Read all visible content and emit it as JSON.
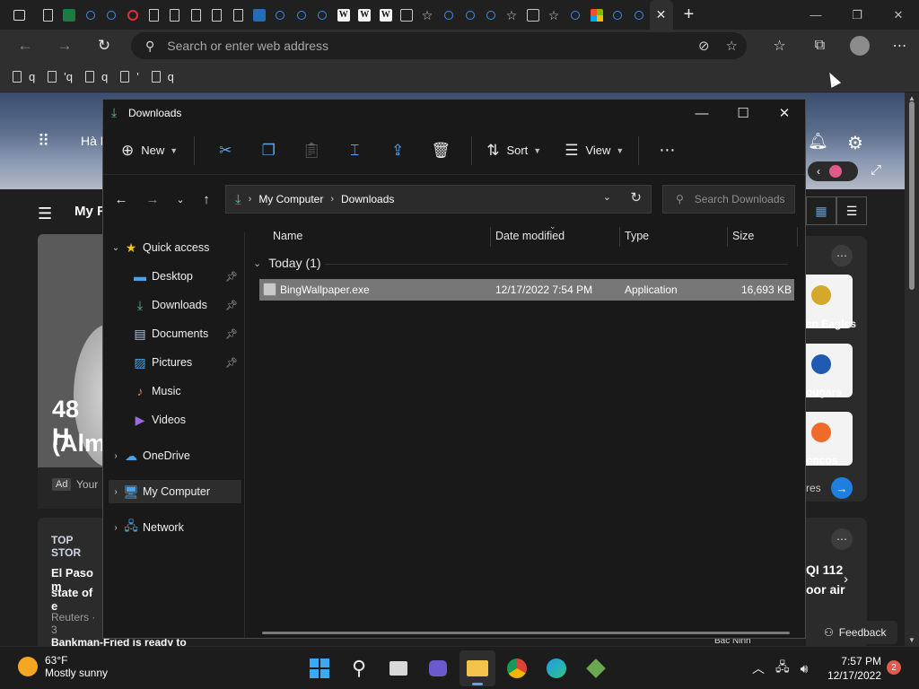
{
  "browser": {
    "address_placeholder": "Search or enter web address",
    "bookmarks": [
      {
        "label": "q"
      },
      {
        "label": "'q"
      },
      {
        "label": "q"
      },
      {
        "label": "'"
      },
      {
        "label": "q"
      }
    ]
  },
  "webpage": {
    "location": "Hà N",
    "feed_label": "My F",
    "hero_line1": "48 H",
    "hero_line2": "(Alm",
    "ad_badge": "Ad",
    "ad_text": "Your",
    "top_stories": "TOP STOR",
    "story_line1": "El Paso m",
    "story_line2": "state of e",
    "story_source": "Reuters · 3",
    "story2": "Bankman-Fried is ready to",
    "sport1": "en Eagles",
    "sport2": "ougars",
    "sport3": "oncos",
    "sports_more": "res",
    "aqi_line1": "QI 112",
    "aqi_line2": "oor air",
    "feedback": "Feedback",
    "map_label": "Bac Ninh"
  },
  "explorer": {
    "title": "Downloads",
    "commands": {
      "new": "New",
      "sort": "Sort",
      "view": "View"
    },
    "path": [
      "My Computer",
      "Downloads"
    ],
    "search_placeholder": "Search Downloads",
    "nav_items": [
      {
        "label": "Quick access",
        "icon": "star-icon"
      },
      {
        "label": "Desktop",
        "icon": "desktop-icon"
      },
      {
        "label": "Downloads",
        "icon": "download-icon"
      },
      {
        "label": "Documents",
        "icon": "document-icon"
      },
      {
        "label": "Pictures",
        "icon": "pictures-icon"
      },
      {
        "label": "Music",
        "icon": "music-icon"
      },
      {
        "label": "Videos",
        "icon": "videos-icon"
      },
      {
        "label": "OneDrive",
        "icon": "cloud-icon"
      },
      {
        "label": "My Computer",
        "icon": "computer-icon"
      },
      {
        "label": "Network",
        "icon": "network-icon"
      }
    ],
    "columns": {
      "name": "Name",
      "date": "Date modified",
      "type": "Type",
      "size": "Size"
    },
    "group": "Today (1)",
    "files": [
      {
        "name": "BingWallpaper.exe",
        "date": "12/17/2022 7:54 PM",
        "type": "Application",
        "size": "16,693 KB"
      }
    ]
  },
  "taskbar": {
    "temperature": "63°F",
    "condition": "Mostly sunny",
    "time": "7:57 PM",
    "date": "12/17/2022",
    "notifications": "2"
  },
  "colors": {
    "accent": "#58a6f2",
    "download_green": "#4fc08d",
    "selected_row": "#777777"
  }
}
